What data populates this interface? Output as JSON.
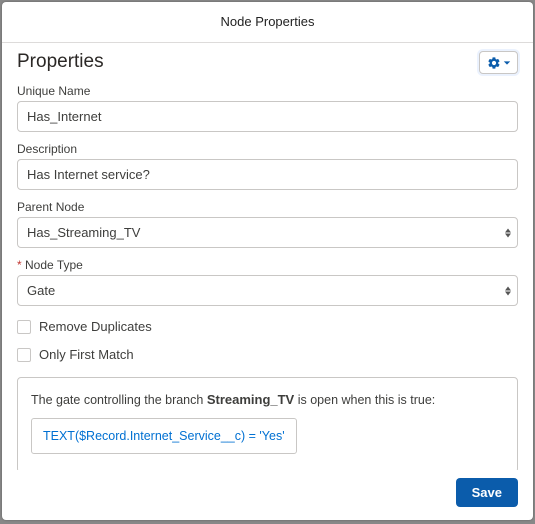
{
  "modal": {
    "title": "Node Properties"
  },
  "section": {
    "title": "Properties"
  },
  "fields": {
    "unique_name": {
      "label": "Unique Name",
      "value": "Has_Internet"
    },
    "description": {
      "label": "Description",
      "value": "Has Internet service?"
    },
    "parent_node": {
      "label": "Parent Node",
      "value": "Has_Streaming_TV"
    },
    "node_type": {
      "label": "Node Type",
      "value": "Gate"
    }
  },
  "checkboxes": {
    "remove_duplicates": {
      "label": "Remove Duplicates",
      "checked": false
    },
    "only_first_match": {
      "label": "Only First Match",
      "checked": false
    }
  },
  "condition": {
    "pre": "The gate controlling the branch ",
    "branch": "Streaming_TV",
    "post": " is open when this is true:",
    "expression": "TEXT($Record.Internet_Service__c) = 'Yes'"
  },
  "footer": {
    "save": "Save"
  }
}
